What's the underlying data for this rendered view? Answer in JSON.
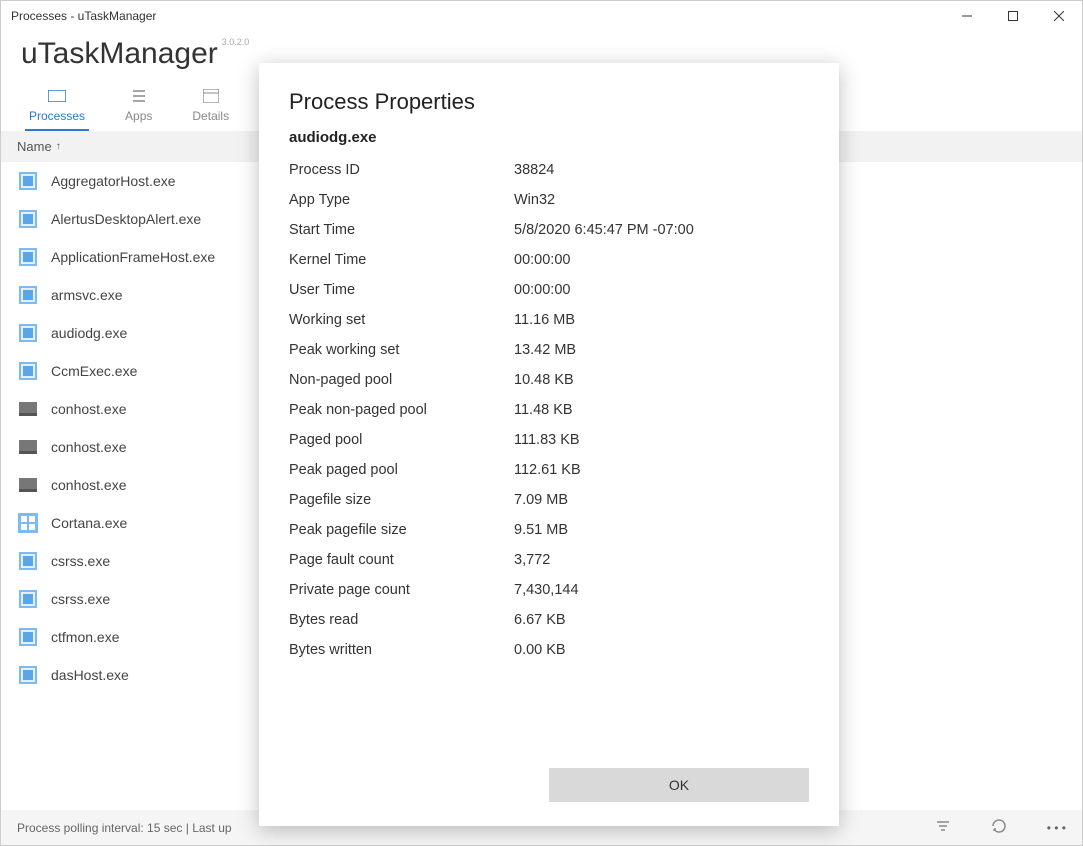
{
  "titlebar": {
    "text": "Processes - uTaskManager"
  },
  "app": {
    "name": "uTaskManager",
    "version": "3.0.2.0"
  },
  "tabs": {
    "t0": {
      "label": "Processes"
    },
    "t1": {
      "label": "Apps"
    },
    "t2": {
      "label": "Details"
    }
  },
  "colhead": {
    "name": "Name",
    "sort": "↑"
  },
  "rows": {
    "r0": "AggregatorHost.exe",
    "r1": "AlertusDesktopAlert.exe",
    "r2": "ApplicationFrameHost.exe",
    "r3": "armsvc.exe",
    "r4": "audiodg.exe",
    "r5": "CcmExec.exe",
    "r6": "conhost.exe",
    "r7": "conhost.exe",
    "r8": "conhost.exe",
    "r9": "Cortana.exe",
    "r10": "csrss.exe",
    "r11": "csrss.exe",
    "r12": "ctfmon.exe",
    "r13": "dasHost.exe"
  },
  "status": {
    "left": "Process polling interval: 15 sec  |  Last up"
  },
  "modal": {
    "title": "Process Properties",
    "process": "audiodg.exe",
    "ok": "OK",
    "props": {
      "p0": {
        "label": "Process ID",
        "value": "38824"
      },
      "p1": {
        "label": "App Type",
        "value": "Win32"
      },
      "p2": {
        "label": "Start Time",
        "value": "5/8/2020 6:45:47 PM -07:00"
      },
      "p3": {
        "label": "Kernel Time",
        "value": "00:00:00"
      },
      "p4": {
        "label": "User Time",
        "value": "00:00:00"
      },
      "p5": {
        "label": "Working set",
        "value": "11.16 MB"
      },
      "p6": {
        "label": "Peak working set",
        "value": "13.42 MB"
      },
      "p7": {
        "label": "Non-paged pool",
        "value": "10.48 KB"
      },
      "p8": {
        "label": "Peak non-paged pool",
        "value": "11.48 KB"
      },
      "p9": {
        "label": "Paged pool",
        "value": "111.83 KB"
      },
      "p10": {
        "label": "Peak paged pool",
        "value": "112.61 KB"
      },
      "p11": {
        "label": "Pagefile size",
        "value": "7.09 MB"
      },
      "p12": {
        "label": "Peak pagefile size",
        "value": "9.51 MB"
      },
      "p13": {
        "label": "Page fault count",
        "value": "3,772"
      },
      "p14": {
        "label": "Private page count",
        "value": "7,430,144"
      },
      "p15": {
        "label": "Bytes read",
        "value": "6.67 KB"
      },
      "p16": {
        "label": "Bytes written",
        "value": "0.00 KB"
      }
    }
  }
}
